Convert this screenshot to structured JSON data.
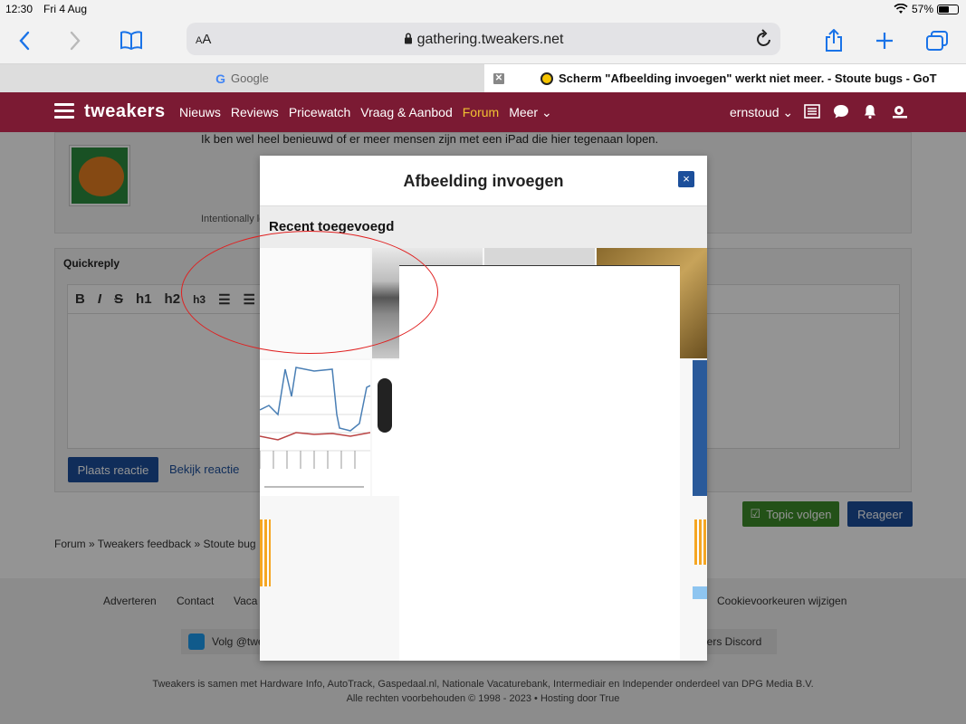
{
  "status_bar": {
    "time": "12:30",
    "date": "Fri 4 Aug",
    "battery": "57%",
    "battery_level": 0.57
  },
  "browser": {
    "text_size_button": "AA",
    "url": "gathering.tweakers.net",
    "tabs": [
      {
        "label": "Google",
        "active": false
      },
      {
        "label": "Scherm \"Afbeelding invoegen\" werkt niet meer. - Stoute bugs - GoT",
        "active": true
      }
    ]
  },
  "site_nav": {
    "logo": "tweakers",
    "items": [
      "Nieuws",
      "Reviews",
      "Pricewatch",
      "Vraag & Aanbod",
      "Forum",
      "Meer"
    ],
    "active_item": "Forum",
    "user": "ernstoud"
  },
  "post": {
    "text": "Ik ben wel heel benieuwd of er meer mensen zijn met een iPad die hier tegenaan lopen.",
    "signature": "Intentionally le"
  },
  "quickreply": {
    "title": "Quickreply",
    "toolbar": [
      "B",
      "I",
      "S",
      "h1",
      "h2",
      "h3"
    ],
    "submit_label": "Plaats reactie",
    "preview_label": "Bekijk reactie"
  },
  "actions": {
    "follow_label": "Topic volgen",
    "reply_label": "Reageer"
  },
  "breadcrumb": [
    "Forum",
    "Tweakers feedback",
    "Stoute bug"
  ],
  "footer": {
    "links": [
      "Adverteren",
      "Contact",
      "Vaca",
      "Cookievoorkeuren wijzigen"
    ],
    "twitter_label": "Volg @twe",
    "discord_label": "akers Discord",
    "line1": "Tweakers is samen met Hardware Info, AutoTrack, Gaspedaal.nl, Nationale Vacaturebank, Intermediair en Independer onderdeel van DPG Media B.V.",
    "line2": "Alle rechten voorbehouden © 1998 - 2023  •  Hosting door True"
  },
  "modal": {
    "title": "Afbeelding invoegen",
    "close_label": "×",
    "section_title": "Recent toegevoegd"
  },
  "colors": {
    "brand": "#7b1a33",
    "accent": "#1c4f9b",
    "highlight": "#f1c232",
    "annotation": "#e02020"
  }
}
